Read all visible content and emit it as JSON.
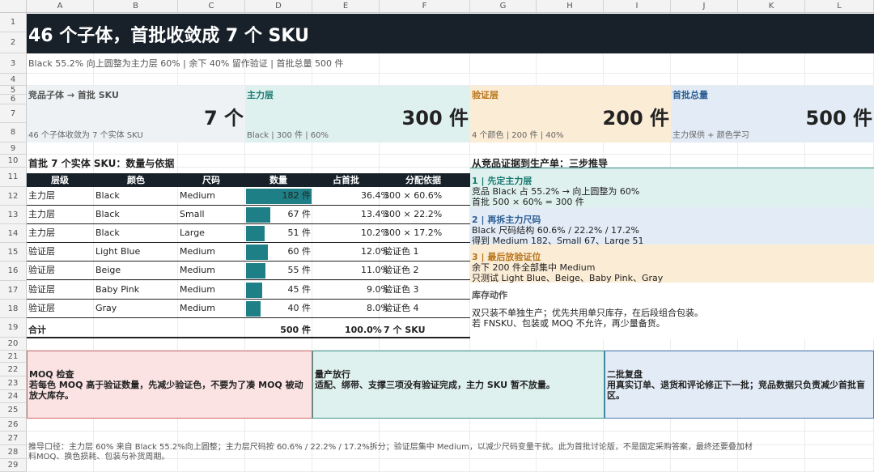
{
  "sheet": {
    "columns": [
      "A",
      "B",
      "C",
      "D",
      "E",
      "F",
      "G",
      "H",
      "I",
      "J",
      "K",
      "L"
    ],
    "rows": [
      "1",
      "2",
      "3",
      "4",
      "5",
      "6",
      "7",
      "8",
      "9",
      "10",
      "11",
      "12",
      "13",
      "14",
      "15",
      "16",
      "17",
      "18",
      "19",
      "20",
      "21",
      "22",
      "23",
      "24",
      "25",
      "26",
      "27",
      "28",
      "29"
    ]
  },
  "title": "46 个子体，首批收敛成 7 个 SKU",
  "subtitle": "Black 55.2% 向上圆整为主力层 60% | 余下 40% 留作验证 | 首批总量 500 件",
  "kpis": [
    {
      "label": "竞品子体 → 首批 SKU",
      "value": "7 个",
      "note": "46 个子体收敛为 7 个实体 SKU",
      "bg": "#eef2f4",
      "color": "#555555"
    },
    {
      "label": "主力层",
      "value": "300 件",
      "note": "Black | 300 件 | 60%",
      "bg": "#dff1ee",
      "color": "#1a7a72"
    },
    {
      "label": "验证层",
      "value": "200 件",
      "note": "4 个颜色 | 200 件 | 40%",
      "bg": "#fbecd6",
      "color": "#b8741a"
    },
    {
      "label": "首批总量",
      "value": "500 件",
      "note": "主力保供 + 颜色学习",
      "bg": "#e3ecf6",
      "color": "#2f5f95"
    }
  ],
  "table": {
    "section_title": "首批 7 个实体 SKU：数量与依据",
    "headers": [
      "层级",
      "颜色",
      "尺码",
      "数量",
      "占首批",
      "分配依据"
    ],
    "rows": [
      {
        "tier": "主力层",
        "color": "Black",
        "size": "Medium",
        "qty": 182,
        "qty_label": "182 件",
        "share": "36.4%",
        "basis": "300 × 60.6%"
      },
      {
        "tier": "主力层",
        "color": "Black",
        "size": "Small",
        "qty": 67,
        "qty_label": "67 件",
        "share": "13.4%",
        "basis": "300 × 22.2%"
      },
      {
        "tier": "主力层",
        "color": "Black",
        "size": "Large",
        "qty": 51,
        "qty_label": "51 件",
        "share": "10.2%",
        "basis": "300 × 17.2%"
      },
      {
        "tier": "验证层",
        "color": "Light Blue",
        "size": "Medium",
        "qty": 60,
        "qty_label": "60 件",
        "share": "12.0%",
        "basis": "验证色 1"
      },
      {
        "tier": "验证层",
        "color": "Beige",
        "size": "Medium",
        "qty": 55,
        "qty_label": "55 件",
        "share": "11.0%",
        "basis": "验证色 2"
      },
      {
        "tier": "验证层",
        "color": "Baby Pink",
        "size": "Medium",
        "qty": 45,
        "qty_label": "45 件",
        "share": "9.0%",
        "basis": "验证色 3"
      },
      {
        "tier": "验证层",
        "color": "Gray",
        "size": "Medium",
        "qty": 40,
        "qty_label": "40 件",
        "share": "8.0%",
        "basis": "验证色 4"
      }
    ],
    "bar_max": 182,
    "bar_color": "#1f7f86",
    "total": {
      "label": "合计",
      "qty": "500 件",
      "share": "100.0%",
      "basis": "7 个 SKU"
    }
  },
  "steps": {
    "section_title": "从竞品证据到生产单：三步推导",
    "items": [
      {
        "heading": "1 | 先定主力层",
        "lines": [
          "竞品 Black 占 55.2% → 向上圆整为 60%",
          "首批 500 × 60% = 300 件"
        ],
        "bg": "#dff1ee",
        "color": "#1a7a72"
      },
      {
        "heading": "2 | 再拆主力尺码",
        "lines": [
          "Black 尺码结构 60.6% / 22.2% / 17.2%",
          "得到 Medium 182、Small 67、Large 51"
        ],
        "bg": "#e3ecf6",
        "color": "#2f5f95"
      },
      {
        "heading": "3 | 最后放验证位",
        "lines": [
          "余下 200 件全部集中 Medium",
          "只测试 Light Blue、Beige、Baby Pink、Gray"
        ],
        "bg": "#fbecd6",
        "color": "#b8741a"
      }
    ],
    "inventory": {
      "heading": "库存动作",
      "lines": [
        "双只装不单独生产；优先共用单只库存，在后段组合包装。",
        "若 FNSKU、包装或 MOQ 不允许，再少量备货。"
      ]
    }
  },
  "boxes": [
    {
      "title": "MOQ 检查",
      "text": "若每色 MOQ 高于验证数量，先减少验证色，不要为了凑 MOQ 被动放大库存。",
      "bg": "#fbe3e3",
      "border": "#d06a6a"
    },
    {
      "title": "量产放行",
      "text": "适配、绑带、支撑三项没有验证完成，主力 SKU 暂不放量。",
      "bg": "#dff1ee",
      "border": "#3a958c"
    },
    {
      "title": "二批复盘",
      "text": "用真实订单、退货和评论修正下一批；竞品数据只负责减少首批盲区。",
      "bg": "#e3ecf6",
      "border": "#4a78b5"
    }
  ],
  "footnote": "推导口径：主力层 60% 来自 Black 55.2%向上圆整；主力层尺码按 60.6% / 22.2% / 17.2%拆分；验证层集中 Medium，以减少尺码变量干扰。此为首批讨论版，不是固定采购答案，最终还要叠加材料MOQ、换色损耗、包装与补货周期。"
}
